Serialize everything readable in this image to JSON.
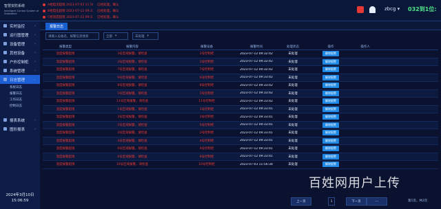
{
  "header": {
    "logo_title": "智慧安防系统",
    "logo_subtitle": "Intelligent Control System of Substation",
    "alarms": [
      {
        "text": "A相电流超限 2023-07-03 11:56:23",
        "tag": "已经处理，确认"
      },
      {
        "text": "B相电压超限 2023-07-12 09:33:41",
        "tag": "已经处理，确认"
      },
      {
        "text": "C相温度超限 2023-07-12 09:33:42",
        "tag": "已经处理，确认"
      }
    ],
    "user": "zbcg",
    "clock": "032到1位:"
  },
  "sidebar": {
    "items": [
      {
        "label": "实时监控",
        "active": false
      },
      {
        "label": "运行图管理",
        "active": false
      },
      {
        "label": "设备管理",
        "active": false
      },
      {
        "label": "其他设备",
        "active": false
      },
      {
        "label": "户外控制柜",
        "active": false
      },
      {
        "label": "系统管理",
        "active": false
      },
      {
        "label": "日志管理",
        "active": true
      }
    ],
    "subitems": [
      "系统日志",
      "报警日志",
      "工作日志",
      "控制日志"
    ],
    "items2": [
      {
        "label": "报表系统"
      },
      {
        "label": "图形报表"
      }
    ],
    "date": "2024年3月10日",
    "time": "15:06:59"
  },
  "main": {
    "tab": "报警日志",
    "filters": {
      "search_placeholder": "请输入设备名，报警信息搜索",
      "select1": "全部",
      "select2": "未处理"
    },
    "columns": [
      "报警类型",
      "报警内容",
      "报警设备",
      "报警时间",
      "处理状态",
      "操作",
      "操作人"
    ],
    "rows": [
      {
        "type": "温度报警超限",
        "content": "3号区域报警，请检查",
        "device": "2号控制柜",
        "time": "2023-07-12 09:32:42",
        "status": "未处理",
        "op": "解除报警"
      },
      {
        "type": "温度报警超限",
        "content": "2号区域报警，请检查",
        "device": "1号控制柜",
        "time": "2023-07-12 09:32:42",
        "status": "未处理",
        "op": "解除报警"
      },
      {
        "type": "温度报警超限",
        "content": "7号区域报警，请检查",
        "device": "7号控制柜",
        "time": "2023-07-12 09:32:42",
        "status": "未处理",
        "op": "解除报警"
      },
      {
        "type": "温度报警超限",
        "content": "9号区域报警，请检查",
        "device": "6号控制柜",
        "time": "2023-07-12 09:33:42",
        "status": "未处理",
        "op": "解除报警"
      },
      {
        "type": "温度报警超限",
        "content": "8号区域报警，请检查",
        "device": "8号控制柜",
        "time": "2023-07-12 09:33:42",
        "status": "未处理",
        "op": "解除报警"
      },
      {
        "type": "温度报警超限",
        "content": "5号区域报警，请检查",
        "device": "5号控制柜",
        "time": "2023-07-12 09:33:42",
        "status": "未处理",
        "op": "解除报警"
      },
      {
        "type": "温度报警超限",
        "content": "11号区域报警，请检查",
        "device": "11号控制柜",
        "time": "2023-07-12 09:33:42",
        "status": "未处理",
        "op": "解除报警"
      },
      {
        "type": "温度报警超限",
        "content": "1号区域报警，请检查",
        "device": "1号控制柜",
        "time": "2023-07-12 09:33:41",
        "status": "未处理",
        "op": "解除报警"
      },
      {
        "type": "温度报警超限",
        "content": "3号区域报警，请检查",
        "device": "3号控制柜",
        "time": "2023-07-12 09:33:41",
        "status": "未处理",
        "op": "解除报警"
      },
      {
        "type": "温度报警超限",
        "content": "5号区域报警，请检查",
        "device": "5号控制柜",
        "time": "2023-07-12 09:33:41",
        "status": "未处理",
        "op": "解除报警"
      },
      {
        "type": "温度报警超限",
        "content": "2号区域报警，请检查",
        "device": "2号控制柜",
        "time": "2023-07-12 09:33:41",
        "status": "未处理",
        "op": "解除报警"
      },
      {
        "type": "温度报警超限",
        "content": "4号区域报警，请检查",
        "device": "4号控制柜",
        "time": "2023-07-12 09:33:41",
        "status": "未处理",
        "op": "解除报警"
      },
      {
        "type": "温度报警超限",
        "content": "9号区域报警，请检查",
        "device": "9号控制柜",
        "time": "2023-07-12 09:33:41",
        "status": "未处理",
        "op": "解除报警"
      },
      {
        "type": "温度报警超限",
        "content": "6号区域报警，请检查",
        "device": "6号控制柜",
        "time": "2023-07-12 09:33:41",
        "status": "未处理",
        "op": "解除报警"
      },
      {
        "type": "温度报警超限",
        "content": "10号区域报警，请检查",
        "device": "10号控制柜",
        "time": "2023-07-03 11:56:34",
        "status": "未处理",
        "op": "解除报警"
      }
    ],
    "pager": {
      "prev": "上一页",
      "page": "1",
      "next": "下一页",
      "info": "第1页，共2页"
    }
  },
  "watermark": "百姓网用户上传",
  "colors": {
    "alarm": "#e53935",
    "accent": "#1f5fd6",
    "button": "#1e88e5",
    "clock": "#4ee48a"
  }
}
